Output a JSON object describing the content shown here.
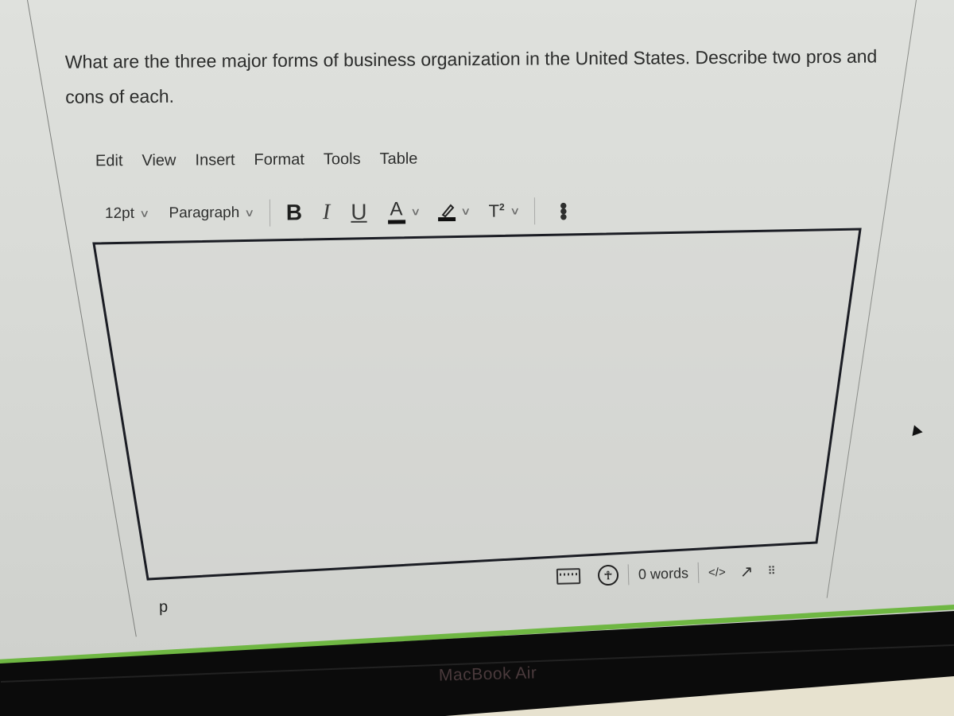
{
  "question": {
    "text": "What are the three major forms of business organization in the United States. Describe two pros and cons of each."
  },
  "editor": {
    "menubar": [
      "Edit",
      "View",
      "Insert",
      "Format",
      "Tools",
      "Table"
    ],
    "toolbar": {
      "font_size": "12pt",
      "block_format": "Paragraph",
      "bold_label": "B",
      "italic_label": "I",
      "underline_label": "U",
      "text_color_label": "A",
      "superscript_label": "T",
      "superscript_mark": "2",
      "more_label": "⋮"
    },
    "content": "",
    "statusbar": {
      "path": "p",
      "word_count": "0 words",
      "html_editor_label": "</>",
      "fullscreen_icon": "↗",
      "resize_handle": "⠿"
    }
  },
  "device": {
    "brand": "MacBook Air"
  },
  "colors": {
    "accent_green": "#6fb743",
    "editor_border": "#1b1d24"
  }
}
